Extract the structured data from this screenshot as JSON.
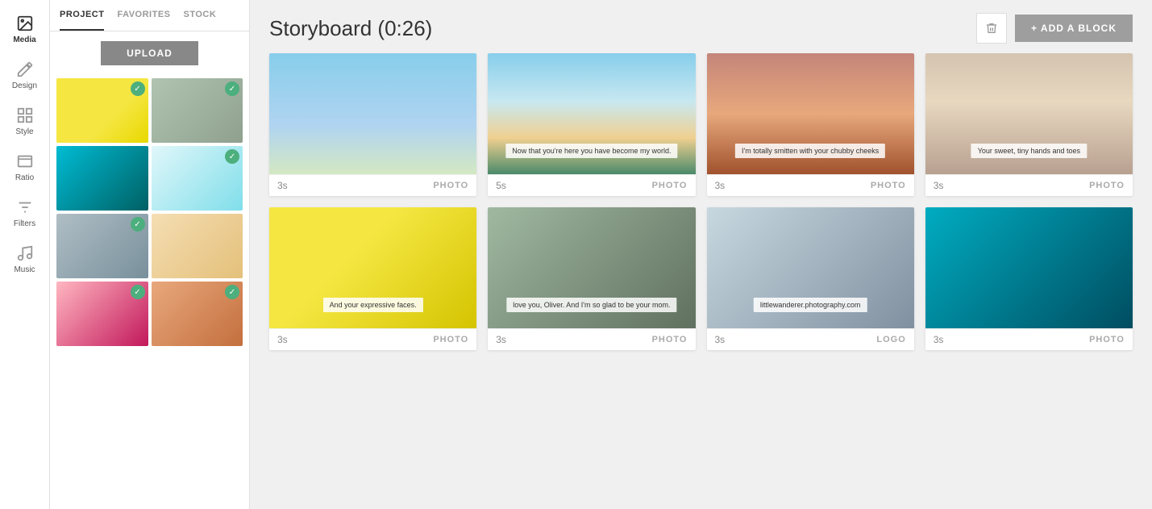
{
  "iconSidebar": {
    "items": [
      {
        "id": "media",
        "label": "Media",
        "icon": "image",
        "active": true
      },
      {
        "id": "design",
        "label": "Design",
        "icon": "brush"
      },
      {
        "id": "style",
        "label": "Style",
        "icon": "grid"
      },
      {
        "id": "ratio",
        "label": "Ratio",
        "icon": "ratio"
      },
      {
        "id": "filters",
        "label": "Filters",
        "icon": "filters"
      },
      {
        "id": "music",
        "label": "Music",
        "icon": "music"
      }
    ]
  },
  "mediaPanel": {
    "tabs": [
      {
        "id": "project",
        "label": "PROJECT",
        "active": true
      },
      {
        "id": "favorites",
        "label": "FAVORITES",
        "active": false
      },
      {
        "id": "stock",
        "label": "STOCK",
        "active": false
      }
    ],
    "uploadLabel": "UPLOAD",
    "thumbnails": [
      {
        "id": 1,
        "colorClass": "thumb-emoji",
        "checked": true
      },
      {
        "id": 2,
        "colorClass": "thumb-elephant",
        "checked": true
      },
      {
        "id": 3,
        "colorClass": "thumb-ocean1",
        "checked": false
      },
      {
        "id": 4,
        "colorClass": "thumb-ocean2",
        "checked": true
      },
      {
        "id": 5,
        "colorClass": "thumb-statue",
        "checked": true
      },
      {
        "id": 6,
        "colorClass": "thumb-beach",
        "checked": false
      },
      {
        "id": 7,
        "colorClass": "thumb-pink",
        "checked": true
      },
      {
        "id": 8,
        "colorClass": "thumb-canyon",
        "checked": true
      }
    ]
  },
  "storyboard": {
    "title": "Storyboard (0:26)",
    "deleteLabel": "",
    "addBlockLabel": "+ ADD A BLOCK",
    "rows": [
      {
        "blocks": [
          {
            "id": 1,
            "colorClass": "bi-sky",
            "time": "3s",
            "type": "PHOTO",
            "caption": ""
          },
          {
            "id": 2,
            "colorClass": "bi-coast",
            "time": "5s",
            "type": "PHOTO",
            "caption": "Now that you're here you have become my world."
          },
          {
            "id": 3,
            "colorClass": "bi-canyon",
            "time": "3s",
            "type": "PHOTO",
            "caption": "I'm totally smitten with your chubby cheeks"
          },
          {
            "id": 4,
            "colorClass": "bi-desert",
            "time": "3s",
            "type": "PHOTO",
            "caption": "Your sweet, tiny hands and toes"
          }
        ]
      },
      {
        "blocks": [
          {
            "id": 5,
            "colorClass": "bi-emoji-big",
            "time": "3s",
            "type": "PHOTO",
            "caption": "And your expressive faces."
          },
          {
            "id": 6,
            "colorClass": "bi-elephant2",
            "time": "3s",
            "type": "PHOTO",
            "caption": "love you, Oliver. And I'm so glad to be your mom."
          },
          {
            "id": 7,
            "colorClass": "bi-statue2",
            "time": "3s",
            "type": "LOGO",
            "caption": "littlewanderer.photography.com"
          },
          {
            "id": 8,
            "colorClass": "bi-ocean3",
            "time": "3s",
            "type": "PHOTO",
            "caption": ""
          }
        ]
      }
    ]
  }
}
